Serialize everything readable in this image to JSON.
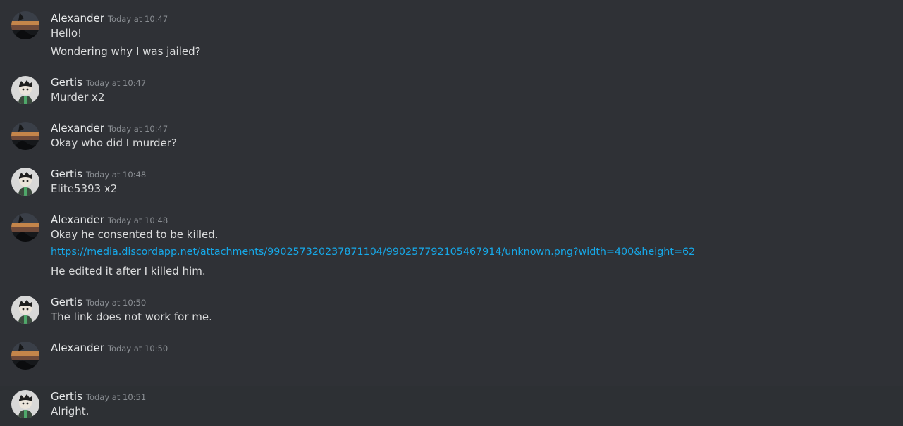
{
  "users": {
    "alexander": "Alexander",
    "gertis": "Gertis"
  },
  "messages": [
    {
      "user": "Alexander",
      "time": "Today at 10:47",
      "lines": [
        "Hello!",
        "Wondering why I was jailed?"
      ]
    },
    {
      "user": "Gertis",
      "time": "Today at 10:47",
      "lines": [
        "Murder x2"
      ]
    },
    {
      "user": "Alexander",
      "time": "Today at 10:47",
      "lines": [
        "Okay who did I murder?"
      ]
    },
    {
      "user": "Gertis",
      "time": "Today at 10:48",
      "lines": [
        "Elite5393 x2"
      ]
    },
    {
      "user": "Alexander",
      "time": "Today at 10:48",
      "lines": [
        "Okay he consented to be killed.",
        "https://media.discordapp.net/attachments/990257320237871104/990257792105467914/unknown.png?width=400&height=62",
        "He edited it after I killed him."
      ]
    },
    {
      "user": "Gertis",
      "time": "Today at 10:50",
      "lines": [
        "The link does not work for me."
      ]
    },
    {
      "user": "Alexander",
      "time": "Today at 10:50",
      "lines": []
    },
    {
      "user": "Gertis",
      "time": "Today at 10:51",
      "lines": [
        "Alright."
      ]
    }
  ],
  "colors": {
    "background": "#2f3136",
    "username": "#e7e9ea",
    "timestamp": "#8b8f94",
    "text": "#dcddde",
    "link": "#16a8e8"
  },
  "icons": {
    "alexander_avatar": "sunset-avatar-icon",
    "gertis_avatar": "cartoon-avatar-icon"
  }
}
